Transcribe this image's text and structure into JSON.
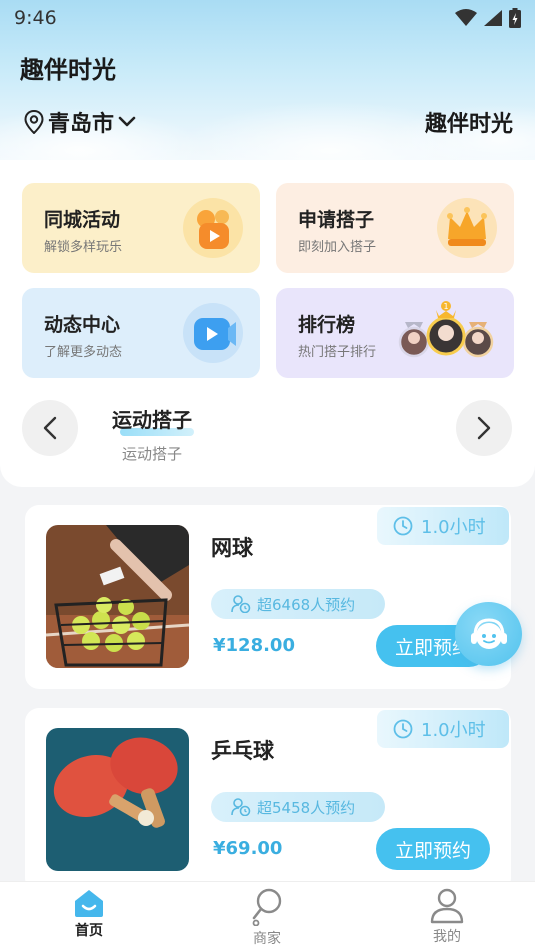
{
  "status_bar": {
    "time": "9:46"
  },
  "header": {
    "app_title": "趣伴时光",
    "city": "青岛市",
    "brand": "趣伴时光"
  },
  "tiles": [
    {
      "title": "同城活动",
      "subtitle": "解锁多样玩乐",
      "icon": "activity-icon"
    },
    {
      "title": "申请搭子",
      "subtitle": "即刻加入搭子",
      "icon": "crown-icon"
    },
    {
      "title": "动态中心",
      "subtitle": "了解更多动态",
      "icon": "play-icon"
    },
    {
      "title": "排行榜",
      "subtitle": "热门搭子排行",
      "icon": "ranking-avatars-icon",
      "rank_badge": "1"
    }
  ],
  "category": {
    "title": "运动搭子",
    "subtitle": "运动搭子"
  },
  "products": [
    {
      "name": "网球",
      "duration": "1.0小时",
      "booked": "超6468人预约",
      "price": "¥128.00",
      "button": "立即预约"
    },
    {
      "name": "乒乓球",
      "duration": "1.0小时",
      "booked": "超5458人预约",
      "price": "¥69.00",
      "button": "立即预约"
    }
  ],
  "tabbar": [
    {
      "label": "首页",
      "icon": "home-icon",
      "active": true
    },
    {
      "label": "商家",
      "icon": "racket-icon",
      "active": false
    },
    {
      "label": "我的",
      "icon": "user-icon",
      "active": false
    }
  ],
  "colors": {
    "accent": "#45c1ef",
    "price": "#3aaee0"
  }
}
